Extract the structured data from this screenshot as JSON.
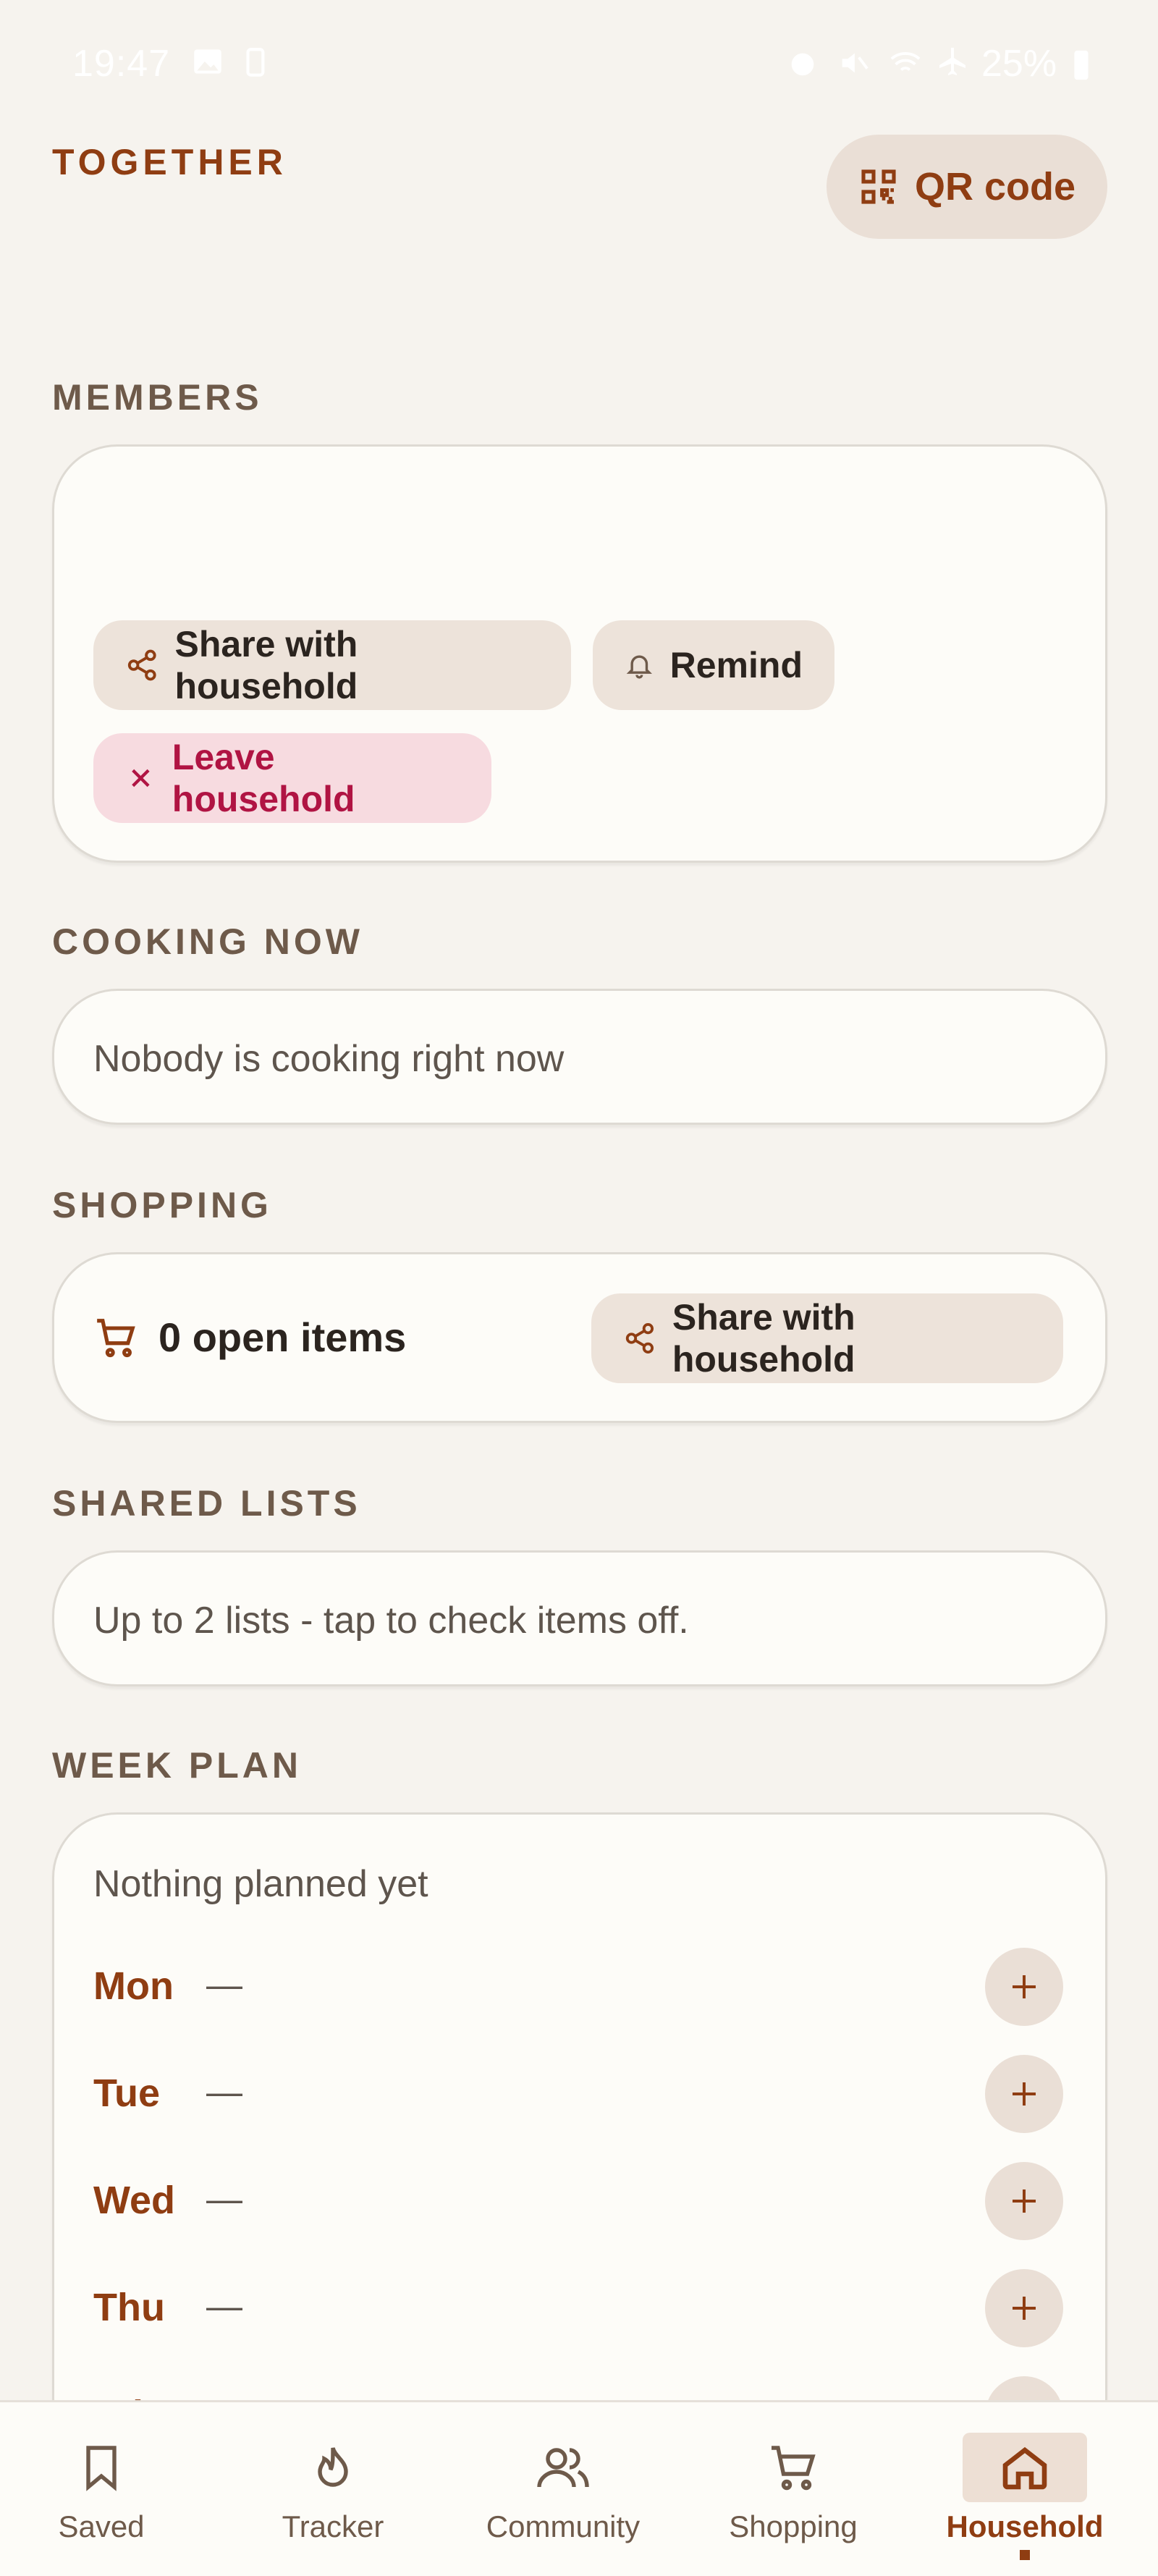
{
  "status_bar": {
    "time": "19:47",
    "battery": "25%"
  },
  "header": {
    "title": "TOGETHER",
    "qr_label": "QR code"
  },
  "members": {
    "label": "MEMBERS",
    "share_label": "Share with household",
    "remind_label": "Remind",
    "leave_label": "Leave household"
  },
  "cooking": {
    "label": "COOKING NOW",
    "text": "Nobody is cooking right now"
  },
  "shopping": {
    "label": "SHOPPING",
    "open_items": "0 open items",
    "share_label": "Share with household"
  },
  "shared_lists": {
    "label": "SHARED LISTS",
    "text": "Up to 2 lists - tap to check items off."
  },
  "week_plan": {
    "label": "WEEK PLAN",
    "empty_text": "Nothing planned yet",
    "days": [
      {
        "name": "Mon",
        "value": "—"
      },
      {
        "name": "Tue",
        "value": "—"
      },
      {
        "name": "Wed",
        "value": "—"
      },
      {
        "name": "Thu",
        "value": "—"
      },
      {
        "name": "Fri",
        "value": "—"
      }
    ]
  },
  "nav": {
    "items": [
      {
        "label": "Saved",
        "icon": "bookmark-icon"
      },
      {
        "label": "Tracker",
        "icon": "flame-icon"
      },
      {
        "label": "Community",
        "icon": "people-icon"
      },
      {
        "label": "Shopping",
        "icon": "cart-icon"
      },
      {
        "label": "Household",
        "icon": "home-icon",
        "active": true
      }
    ]
  },
  "colors": {
    "accent": "#8f3d12",
    "background": "#f6f3ee",
    "card": "#fdfcf8",
    "danger": "#b01443"
  }
}
